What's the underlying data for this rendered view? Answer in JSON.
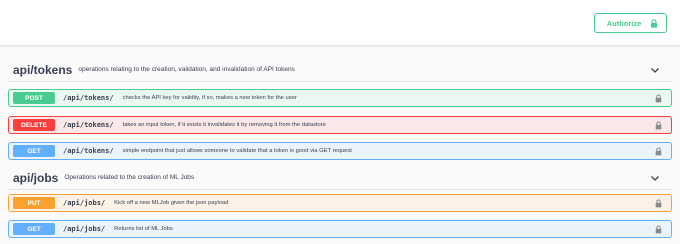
{
  "topbar": {
    "authorize_label": "Authorize"
  },
  "sections": [
    {
      "title": "api/tokens",
      "description": "operations relating to the creation, validation, and invalidation of API tokens",
      "operations": [
        {
          "method": "POST",
          "path": "/api/tokens/",
          "summary": "checks the API key for validity, if so, makes a new token for the user"
        },
        {
          "method": "DELETE",
          "path": "/api/tokens/",
          "summary": "takes an input token, if it exists it invalidates it by removing it from the datastore"
        },
        {
          "method": "GET",
          "path": "/api/tokens/",
          "summary": "simple endpoint that just allows someone to validate that a token is good via GET request"
        }
      ]
    },
    {
      "title": "api/jobs",
      "description": "Operations related to the creation of ML Jobs",
      "operations": [
        {
          "method": "PUT",
          "path": "/api/jobs/",
          "summary": "Kick off a new MLJob given the json payload"
        },
        {
          "method": "GET",
          "path": "/api/jobs/",
          "summary": "Returns list of ML Jobs"
        }
      ]
    }
  ],
  "colors": {
    "post": "#49cc90",
    "delete": "#f93e3e",
    "get": "#61affe",
    "put": "#fca130"
  },
  "icons": {
    "authorize": "lock-icon",
    "operation": "lock-icon",
    "section_toggle": "chevron-down-icon"
  }
}
